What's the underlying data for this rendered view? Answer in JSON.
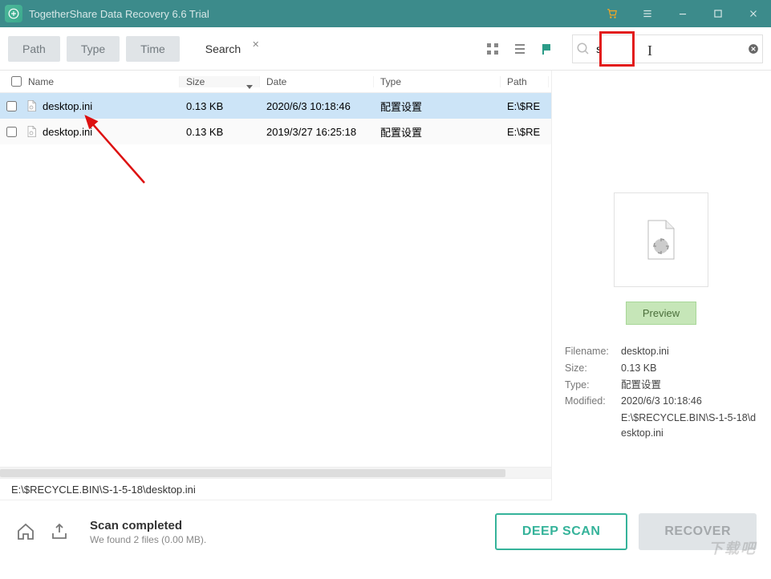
{
  "titlebar": {
    "title": "TogetherShare Data Recovery 6.6 Trial"
  },
  "tabs": {
    "path": "Path",
    "type": "Type",
    "time": "Time",
    "search": "Search"
  },
  "search": {
    "value": "s"
  },
  "columns": {
    "name": "Name",
    "size": "Size",
    "date": "Date",
    "type": "Type",
    "path": "Path"
  },
  "rows": [
    {
      "name": "desktop.ini",
      "size": "0.13 KB",
      "date": "2020/6/3 10:18:46",
      "type": "配置设置",
      "path": "E:\\$RE",
      "selected": true
    },
    {
      "name": "desktop.ini",
      "size": "0.13 KB",
      "date": "2019/3/27 16:25:18",
      "type": "配置设置",
      "path": "E:\\$RE",
      "selected": false
    }
  ],
  "pathbar": "E:\\$RECYCLE.BIN\\S-1-5-18\\desktop.ini",
  "footer": {
    "title": "Scan completed",
    "sub": "We found 2 files (0.00 MB).",
    "deep": "DEEP SCAN",
    "recover": "RECOVER"
  },
  "preview": {
    "button": "Preview",
    "labels": {
      "filename": "Filename:",
      "size": "Size:",
      "type": "Type:",
      "modified": "Modified:"
    },
    "filename": "desktop.ini",
    "size": "0.13 KB",
    "type": "配置设置",
    "modified": "2020/6/3 10:18:46",
    "path": "E:\\$RECYCLE.BIN\\S-1-5-18\\desktop.ini"
  },
  "watermark": "下载吧"
}
